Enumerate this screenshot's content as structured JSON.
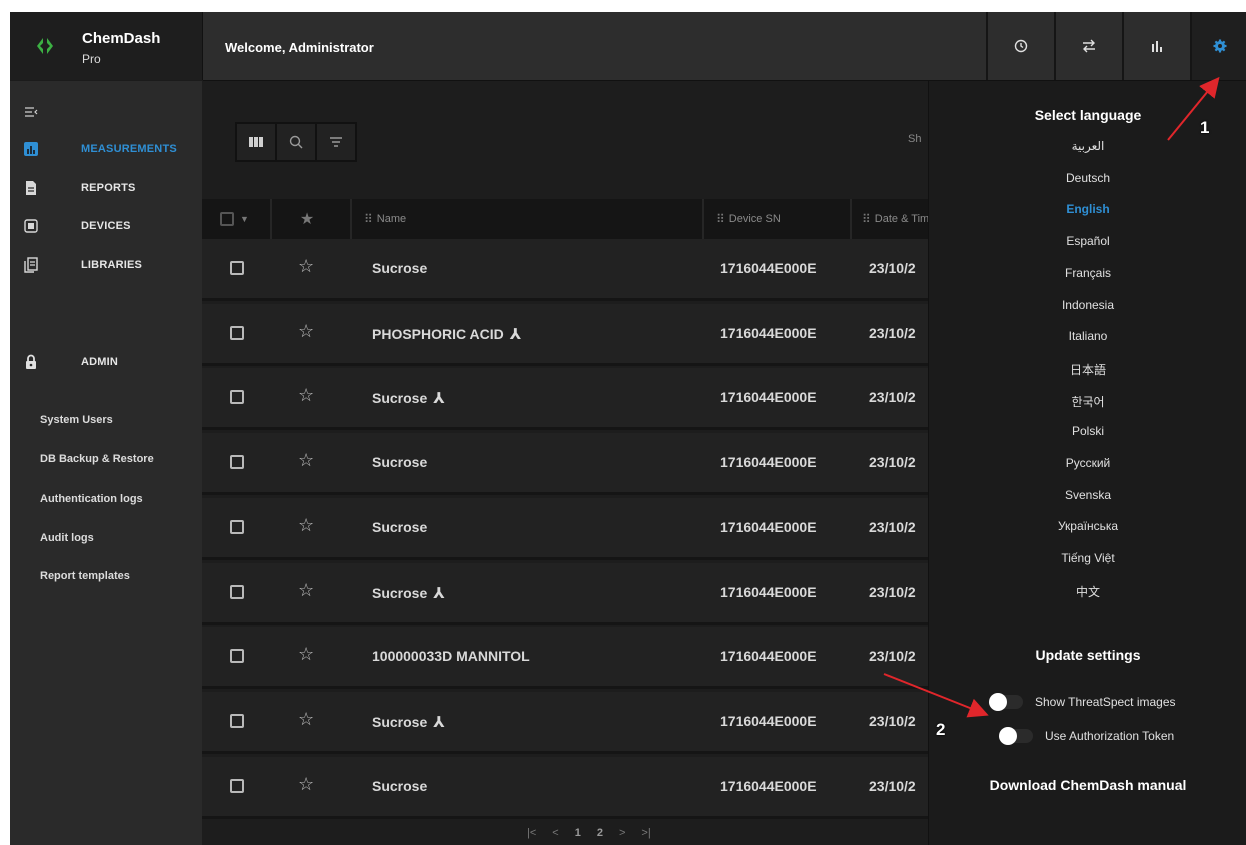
{
  "brand": {
    "title": "ChemDash",
    "subtitle": "Pro"
  },
  "header": {
    "welcome": "Welcome, Administrator",
    "icons": [
      "clock-icon",
      "swap-icon",
      "bar-chart-icon",
      "gear-icon"
    ]
  },
  "sidebar": {
    "items": [
      {
        "label": "MEASUREMENTS",
        "icon": "chart-icon",
        "active": true
      },
      {
        "label": "REPORTS",
        "icon": "report-icon"
      },
      {
        "label": "DEVICES",
        "icon": "device-icon"
      },
      {
        "label": "LIBRARIES",
        "icon": "library-icon"
      }
    ],
    "admin": {
      "label": "ADMIN",
      "icon": "lock-icon",
      "subitems": [
        "System Users",
        "DB Backup & Restore",
        "Authentication logs",
        "Audit logs",
        "Report templates"
      ]
    }
  },
  "toolbar": {
    "buttons": [
      "columns-icon",
      "search-icon",
      "filter-icon"
    ],
    "right_text": "Sh"
  },
  "table": {
    "columns": {
      "name": "Name",
      "device_sn": "Device SN",
      "date": "Date & Time"
    },
    "rows": [
      {
        "name": "Sucrose",
        "merged": false,
        "device_sn": "1716044E000E",
        "date": "23/10/2"
      },
      {
        "name": "PHOSPHORIC ACID",
        "merged": true,
        "device_sn": "1716044E000E",
        "date": "23/10/2"
      },
      {
        "name": "Sucrose",
        "merged": true,
        "device_sn": "1716044E000E",
        "date": "23/10/2"
      },
      {
        "name": "Sucrose",
        "merged": false,
        "device_sn": "1716044E000E",
        "date": "23/10/2"
      },
      {
        "name": "Sucrose",
        "merged": false,
        "device_sn": "1716044E000E",
        "date": "23/10/2"
      },
      {
        "name": "Sucrose",
        "merged": true,
        "device_sn": "1716044E000E",
        "date": "23/10/2"
      },
      {
        "name": "100000033D MANNITOL",
        "merged": false,
        "device_sn": "1716044E000E",
        "date": "23/10/2"
      },
      {
        "name": "Sucrose",
        "merged": true,
        "device_sn": "1716044E000E",
        "date": "23/10/2"
      },
      {
        "name": "Sucrose",
        "merged": false,
        "device_sn": "1716044E000E",
        "date": "23/10/2"
      }
    ],
    "pagination": {
      "first": "|<",
      "prev": "<",
      "pages": [
        "1",
        "2"
      ],
      "next": ">",
      "last": ">|"
    }
  },
  "settings": {
    "language_title": "Select language",
    "languages": [
      "العربية",
      "Deutsch",
      "English",
      "Español",
      "Français",
      "Indonesia",
      "Italiano",
      "日本語",
      "한국어",
      "Polski",
      "Русский",
      "Svenska",
      "Українська",
      "Tiếng Việt",
      "中文"
    ],
    "active_language": "English",
    "update_title": "Update settings",
    "toggles": [
      {
        "label": "Show ThreatSpect images",
        "on": false
      },
      {
        "label": "Use Authorization Token",
        "on": false
      }
    ],
    "download_label": "Download ChemDash manual"
  },
  "annotations": {
    "marker_1": "1",
    "marker_2": "2"
  },
  "colors": {
    "accent": "#2f8fd4",
    "arrow": "#e0262b",
    "brand_green": "#3cb043"
  }
}
